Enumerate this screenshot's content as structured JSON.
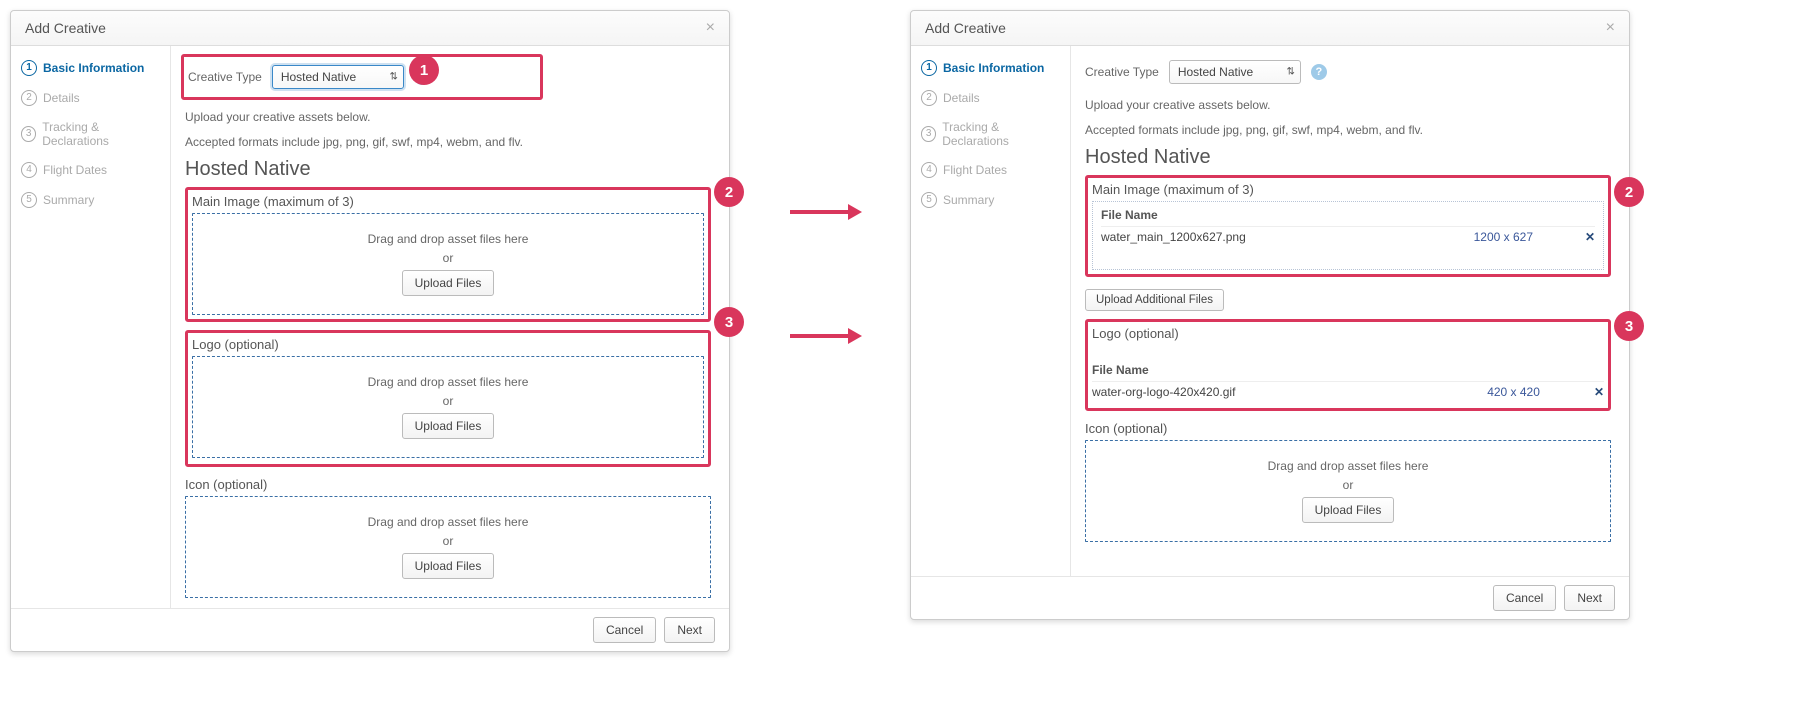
{
  "modal_title": "Add Creative",
  "sidebar": {
    "steps": [
      {
        "num": "1",
        "label": "Basic Information"
      },
      {
        "num": "2",
        "label": "Details"
      },
      {
        "num": "3",
        "label": "Tracking & Declarations"
      },
      {
        "num": "4",
        "label": "Flight Dates"
      },
      {
        "num": "5",
        "label": "Summary"
      }
    ]
  },
  "creative_type_label": "Creative Type",
  "creative_type_value": "Hosted Native",
  "hint_line1": "Upload your creative assets below.",
  "hint_line2": "Accepted formats include jpg, png, gif, swf, mp4, webm, and flv.",
  "section_title": "Hosted Native",
  "blocks": {
    "main_label": "Main Image (maximum of 3)",
    "logo_label": "Logo (optional)",
    "icon_label": "Icon (optional)"
  },
  "dropzone": {
    "line1": "Drag and drop asset files here",
    "line2": "or",
    "button": "Upload Files"
  },
  "upload_additional": "Upload Additional Files",
  "filetable": {
    "header": "File Name",
    "main": {
      "name": "water_main_1200x627.png",
      "dim": "1200 x 627"
    },
    "logo": {
      "name": "water-org-logo-420x420.gif",
      "dim": "420 x 420"
    }
  },
  "footer": {
    "cancel": "Cancel",
    "next": "Next"
  },
  "badges": {
    "b1": "1",
    "b2": "2",
    "b3": "3"
  }
}
